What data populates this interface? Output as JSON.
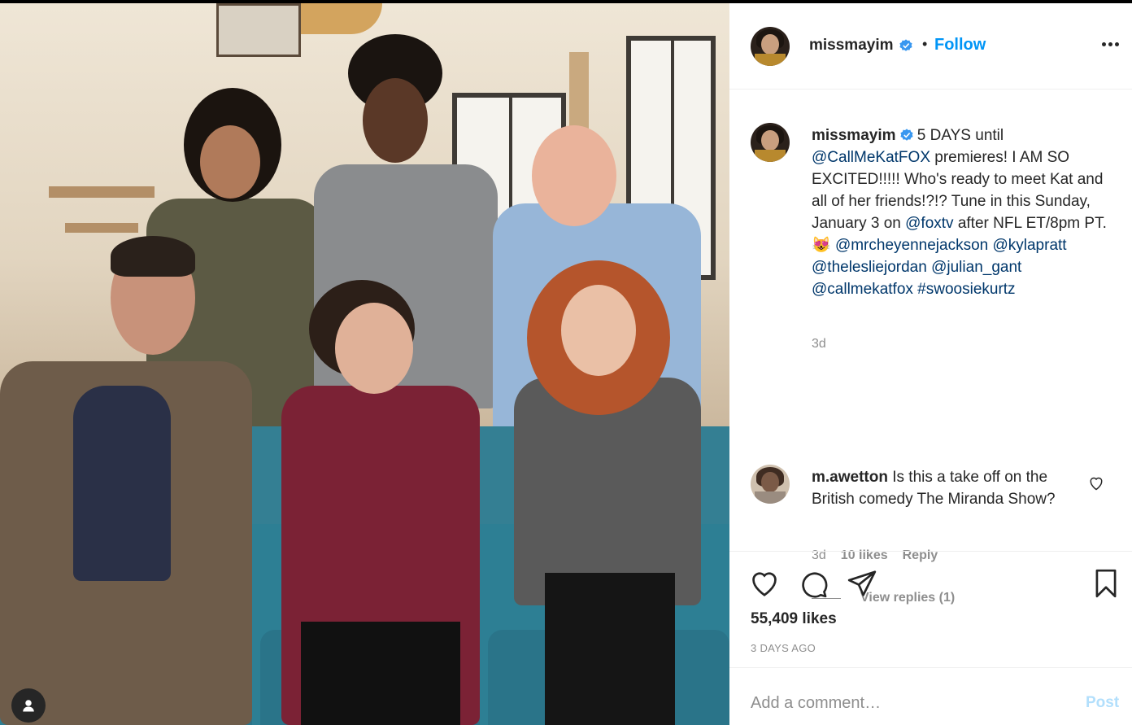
{
  "post": {
    "author": "missmayim",
    "follow_label": "Follow",
    "separator": "•",
    "caption": {
      "author": "missmayim",
      "segments": [
        {
          "type": "text",
          "value": " 5 DAYS until "
        },
        {
          "type": "link",
          "value": "@CallMeKatFOX"
        },
        {
          "type": "text",
          "value": " premieres! I AM SO EXCITED!!!!! Who's ready to meet Kat and all of her friends!?!? Tune in this Sunday, January 3 on "
        },
        {
          "type": "link",
          "value": "@foxtv"
        },
        {
          "type": "text",
          "value": " after NFL ET/8pm PT. 😻 "
        },
        {
          "type": "link",
          "value": "@mrcheyennejackson"
        },
        {
          "type": "text",
          "value": " "
        },
        {
          "type": "link",
          "value": "@kylapratt"
        },
        {
          "type": "text",
          "value": " "
        },
        {
          "type": "link",
          "value": "@thelesliejordan"
        },
        {
          "type": "text",
          "value": " "
        },
        {
          "type": "link",
          "value": "@julian_gant"
        },
        {
          "type": "text",
          "value": " "
        },
        {
          "type": "link",
          "value": "@callmekatfox"
        },
        {
          "type": "text",
          "value": " "
        },
        {
          "type": "link",
          "value": "#swoosiekurtz"
        }
      ],
      "time": "3d"
    },
    "comment": {
      "author": "m.awetton",
      "text": " Is this a take off on the British comedy The Miranda Show?",
      "time": "3d",
      "likes": "10 likes",
      "reply_label": "Reply",
      "view_replies": "View replies (1)"
    },
    "likes": "55,409 likes",
    "posted_ago": "3 DAYS AGO",
    "add_comment_placeholder": "Add a comment…",
    "post_button": "Post"
  },
  "icons": {
    "verified": "verified-badge-icon",
    "more": "more-options-icon",
    "like": "heart-icon",
    "comment": "comment-bubble-icon",
    "share": "paper-plane-icon",
    "save": "bookmark-icon",
    "tagged": "user-tag-icon"
  },
  "colors": {
    "accent": "#0095f6",
    "link": "#00376b",
    "muted": "#8e8e8e",
    "post_disabled": "#b2dffc"
  }
}
